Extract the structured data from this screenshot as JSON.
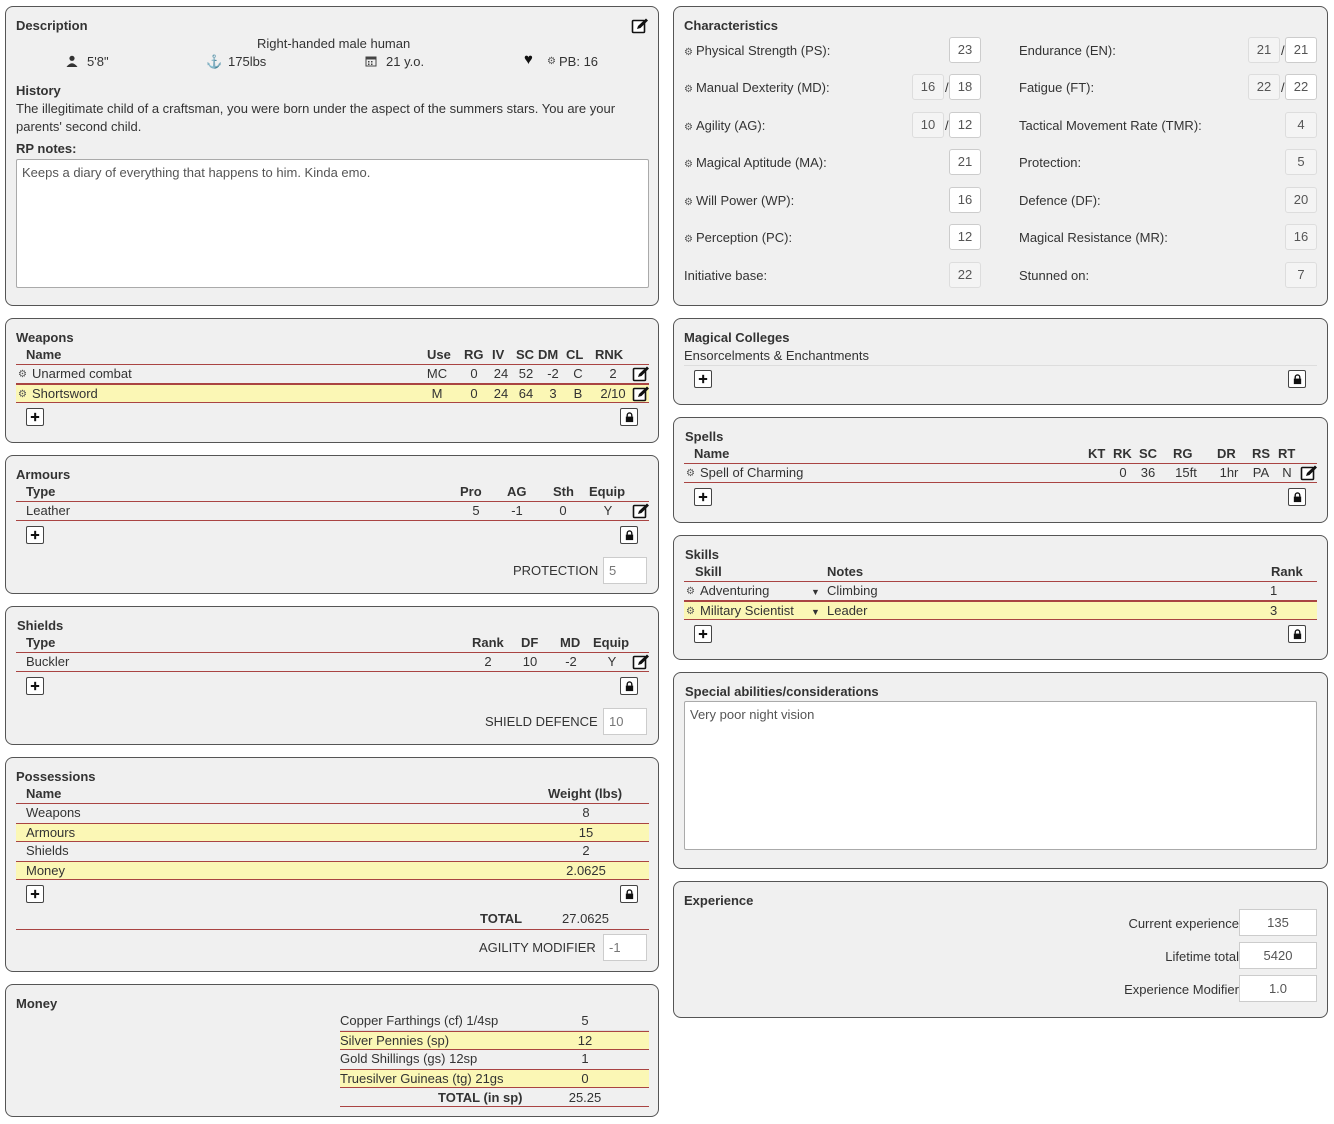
{
  "description": {
    "title": "Description",
    "summary": "Right-handed male human",
    "height": "5'8\"",
    "weight": "175lbs",
    "age": "21 y.o.",
    "pb": "PB: 16",
    "history_label": "History",
    "history_text": "The illegitimate child of a craftsman, you were born under the aspect of the summers stars. You are your parents' second child.",
    "rp_label": "RP notes:",
    "rp_text": "Keeps a diary of everything that happens to him. Kinda emo."
  },
  "characteristics": {
    "title": "Characteristics",
    "left": [
      {
        "label": "Physical Strength (PS):",
        "cog": true,
        "value": "23"
      },
      {
        "label": "Manual Dexterity (MD):",
        "cog": true,
        "current": "16",
        "max": "18"
      },
      {
        "label": "Agility (AG):",
        "cog": true,
        "current": "10",
        "max": "12"
      },
      {
        "label": "Magical Aptitude (MA):",
        "cog": true,
        "value": "21"
      },
      {
        "label": "Will Power (WP):",
        "cog": true,
        "value": "16"
      },
      {
        "label": "Perception (PC):",
        "cog": true,
        "value": "12"
      },
      {
        "label": "Initiative base:",
        "cog": false,
        "value": "22"
      }
    ],
    "right": [
      {
        "label": "Endurance (EN):",
        "current": "21",
        "max": "21"
      },
      {
        "label": "Fatigue (FT):",
        "current": "22",
        "max": "22"
      },
      {
        "label": "Tactical Movement Rate (TMR):",
        "value": "4"
      },
      {
        "label": "Protection:",
        "value": "5"
      },
      {
        "label": "Defence (DF):",
        "value": "20"
      },
      {
        "label": "Magical Resistance (MR):",
        "value": "16"
      },
      {
        "label": "Stunned on:",
        "value": "7"
      }
    ],
    "slash": "/"
  },
  "weapons": {
    "title": "Weapons",
    "headers": [
      "Name",
      "Use",
      "RG",
      "IV",
      "SC",
      "DM",
      "CL",
      "RNK"
    ],
    "rows": [
      {
        "name": "Unarmed combat",
        "use": "MC",
        "rg": "0",
        "iv": "24",
        "sc": "52",
        "dm": "-2",
        "cl": "C",
        "rnk": "2"
      },
      {
        "name": "Shortsword",
        "use": "M",
        "rg": "0",
        "iv": "24",
        "sc": "64",
        "dm": "3",
        "cl": "B",
        "rnk": "2/10"
      }
    ]
  },
  "armours": {
    "title": "Armours",
    "headers": [
      "Type",
      "Pro",
      "AG",
      "Sth",
      "Equip"
    ],
    "rows": [
      {
        "type": "Leather",
        "pro": "5",
        "ag": "-1",
        "sth": "0",
        "equip": "Y"
      }
    ],
    "protection_label": "PROTECTION",
    "protection_value": "5"
  },
  "shields": {
    "title": "Shields",
    "headers": [
      "Type",
      "Rank",
      "DF",
      "MD",
      "Equip"
    ],
    "rows": [
      {
        "type": "Buckler",
        "rank": "2",
        "df": "10",
        "md": "-2",
        "equip": "Y"
      }
    ],
    "defence_label": "SHIELD DEFENCE",
    "defence_value": "10"
  },
  "possessions": {
    "title": "Possessions",
    "headers": [
      "Name",
      "Weight (lbs)"
    ],
    "rows": [
      {
        "name": "Weapons",
        "weight": "8"
      },
      {
        "name": "Armours",
        "weight": "15"
      },
      {
        "name": "Shields",
        "weight": "2"
      },
      {
        "name": "Money",
        "weight": "2.0625"
      }
    ],
    "total_label": "TOTAL",
    "total_value": "27.0625",
    "agility_label": "AGILITY MODIFIER",
    "agility_value": "-1"
  },
  "money": {
    "title": "Money",
    "rows": [
      {
        "name": "Copper Farthings (cf) 1/4sp",
        "value": "5"
      },
      {
        "name": "Silver Pennies (sp)",
        "value": "12"
      },
      {
        "name": "Gold Shillings (gs) 12sp",
        "value": "1"
      },
      {
        "name": "Truesilver Guineas (tg) 21gs",
        "value": "0"
      }
    ],
    "total_label": "TOTAL (in sp)",
    "total_value": "25.25"
  },
  "colleges": {
    "title": "Magical Colleges",
    "items": [
      "Ensorcelments & Enchantments"
    ]
  },
  "spells": {
    "title": "Spells",
    "headers": [
      "Name",
      "KT",
      "RK",
      "SC",
      "RG",
      "DR",
      "RS",
      "RT"
    ],
    "rows": [
      {
        "name": "Spell of Charming",
        "kt": "",
        "rk": "0",
        "sc": "36",
        "rg": "15ft",
        "dr": "1hr",
        "rs": "PA",
        "rt": "N"
      }
    ]
  },
  "skills": {
    "title": "Skills",
    "headers": [
      "Skill",
      "Notes",
      "Rank"
    ],
    "rows": [
      {
        "skill": "Adventuring",
        "notes": "Climbing",
        "rank": "1"
      },
      {
        "skill": "Military Scientist",
        "notes": "Leader",
        "rank": "3"
      }
    ]
  },
  "special": {
    "title": "Special abilities/considerations",
    "text": "Very poor night vision"
  },
  "experience": {
    "title": "Experience",
    "current_label": "Current experience",
    "current_value": "135",
    "lifetime_label": "Lifetime total",
    "lifetime_value": "5420",
    "modifier_label": "Experience Modifier",
    "modifier_value": "1.0"
  },
  "icons": {
    "add": "plus-icon",
    "lock": "lock-icon",
    "edit": "edit-icon",
    "cog": "cog-icon",
    "person": "person-icon",
    "anchor": "anchor-icon",
    "calendar": "calendar-icon",
    "heart": "heart-icon"
  },
  "colors": {
    "panel_bg": "#f0f0f0",
    "row_highlight": "#fbf7b5",
    "row_divider": "#a94442"
  }
}
